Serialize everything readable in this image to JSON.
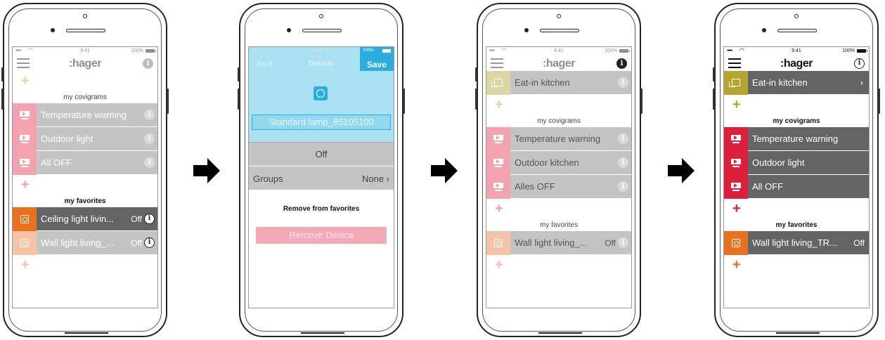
{
  "colors": {
    "disabled_gray": "#c4c4c4",
    "dark_gray": "#646464",
    "scene_red": "#dc1f3a",
    "scene_pink": "#f3a3b0",
    "socket_orange": "#e8701e",
    "socket_peach": "#f5c3a5",
    "room_olive": "#b5a52f",
    "room_khaki": "#dcd6a4",
    "details_blue": "#a9e1f2",
    "save_blue": "#2aaee0",
    "remove_pink": "#f4a9b6"
  },
  "status": {
    "signal": "•••••",
    "time": "9:41",
    "battery": "100%"
  },
  "brand": ":hager",
  "info_glyph": "i",
  "screen1": {
    "covigrams_label": "my covigrams",
    "favorites_label": "my favorites",
    "covigrams": [
      "Temperature warning",
      "Outdoor light",
      "All OFF"
    ],
    "favorites": [
      {
        "label": "Ceiling light livin...",
        "value": "Off"
      },
      {
        "label": "Wall light living_...",
        "value": "Off"
      }
    ]
  },
  "screen2": {
    "back": "‹ Back",
    "title": "Details",
    "save": "Save",
    "device_name": "Standard lamp_85105100",
    "state": "Off",
    "groups_label": "Groups",
    "groups_value": "None ›",
    "remove_favorites": "Remove from favorites",
    "remove_device": "Remove Device"
  },
  "screen3": {
    "room": "Eat-in kitchen",
    "covigrams_label": "my covigrams",
    "favorites_label": "my favorites",
    "covigrams": [
      "Temperature warning",
      "Outdoor kitchen",
      "Alles OFF"
    ],
    "favorites": [
      {
        "label": "Wall light living_...",
        "value": "Off"
      }
    ]
  },
  "screen4": {
    "room": "Eat-in kitchen",
    "room_chevron": "›",
    "covigrams_label": "my covigrams",
    "favorites_label": "my favorites",
    "covigrams": [
      "Temperature warning",
      "Outdoor light",
      "All OFF"
    ],
    "favorites": [
      {
        "label": "Wall light living_TR...",
        "value": "Off"
      }
    ]
  }
}
